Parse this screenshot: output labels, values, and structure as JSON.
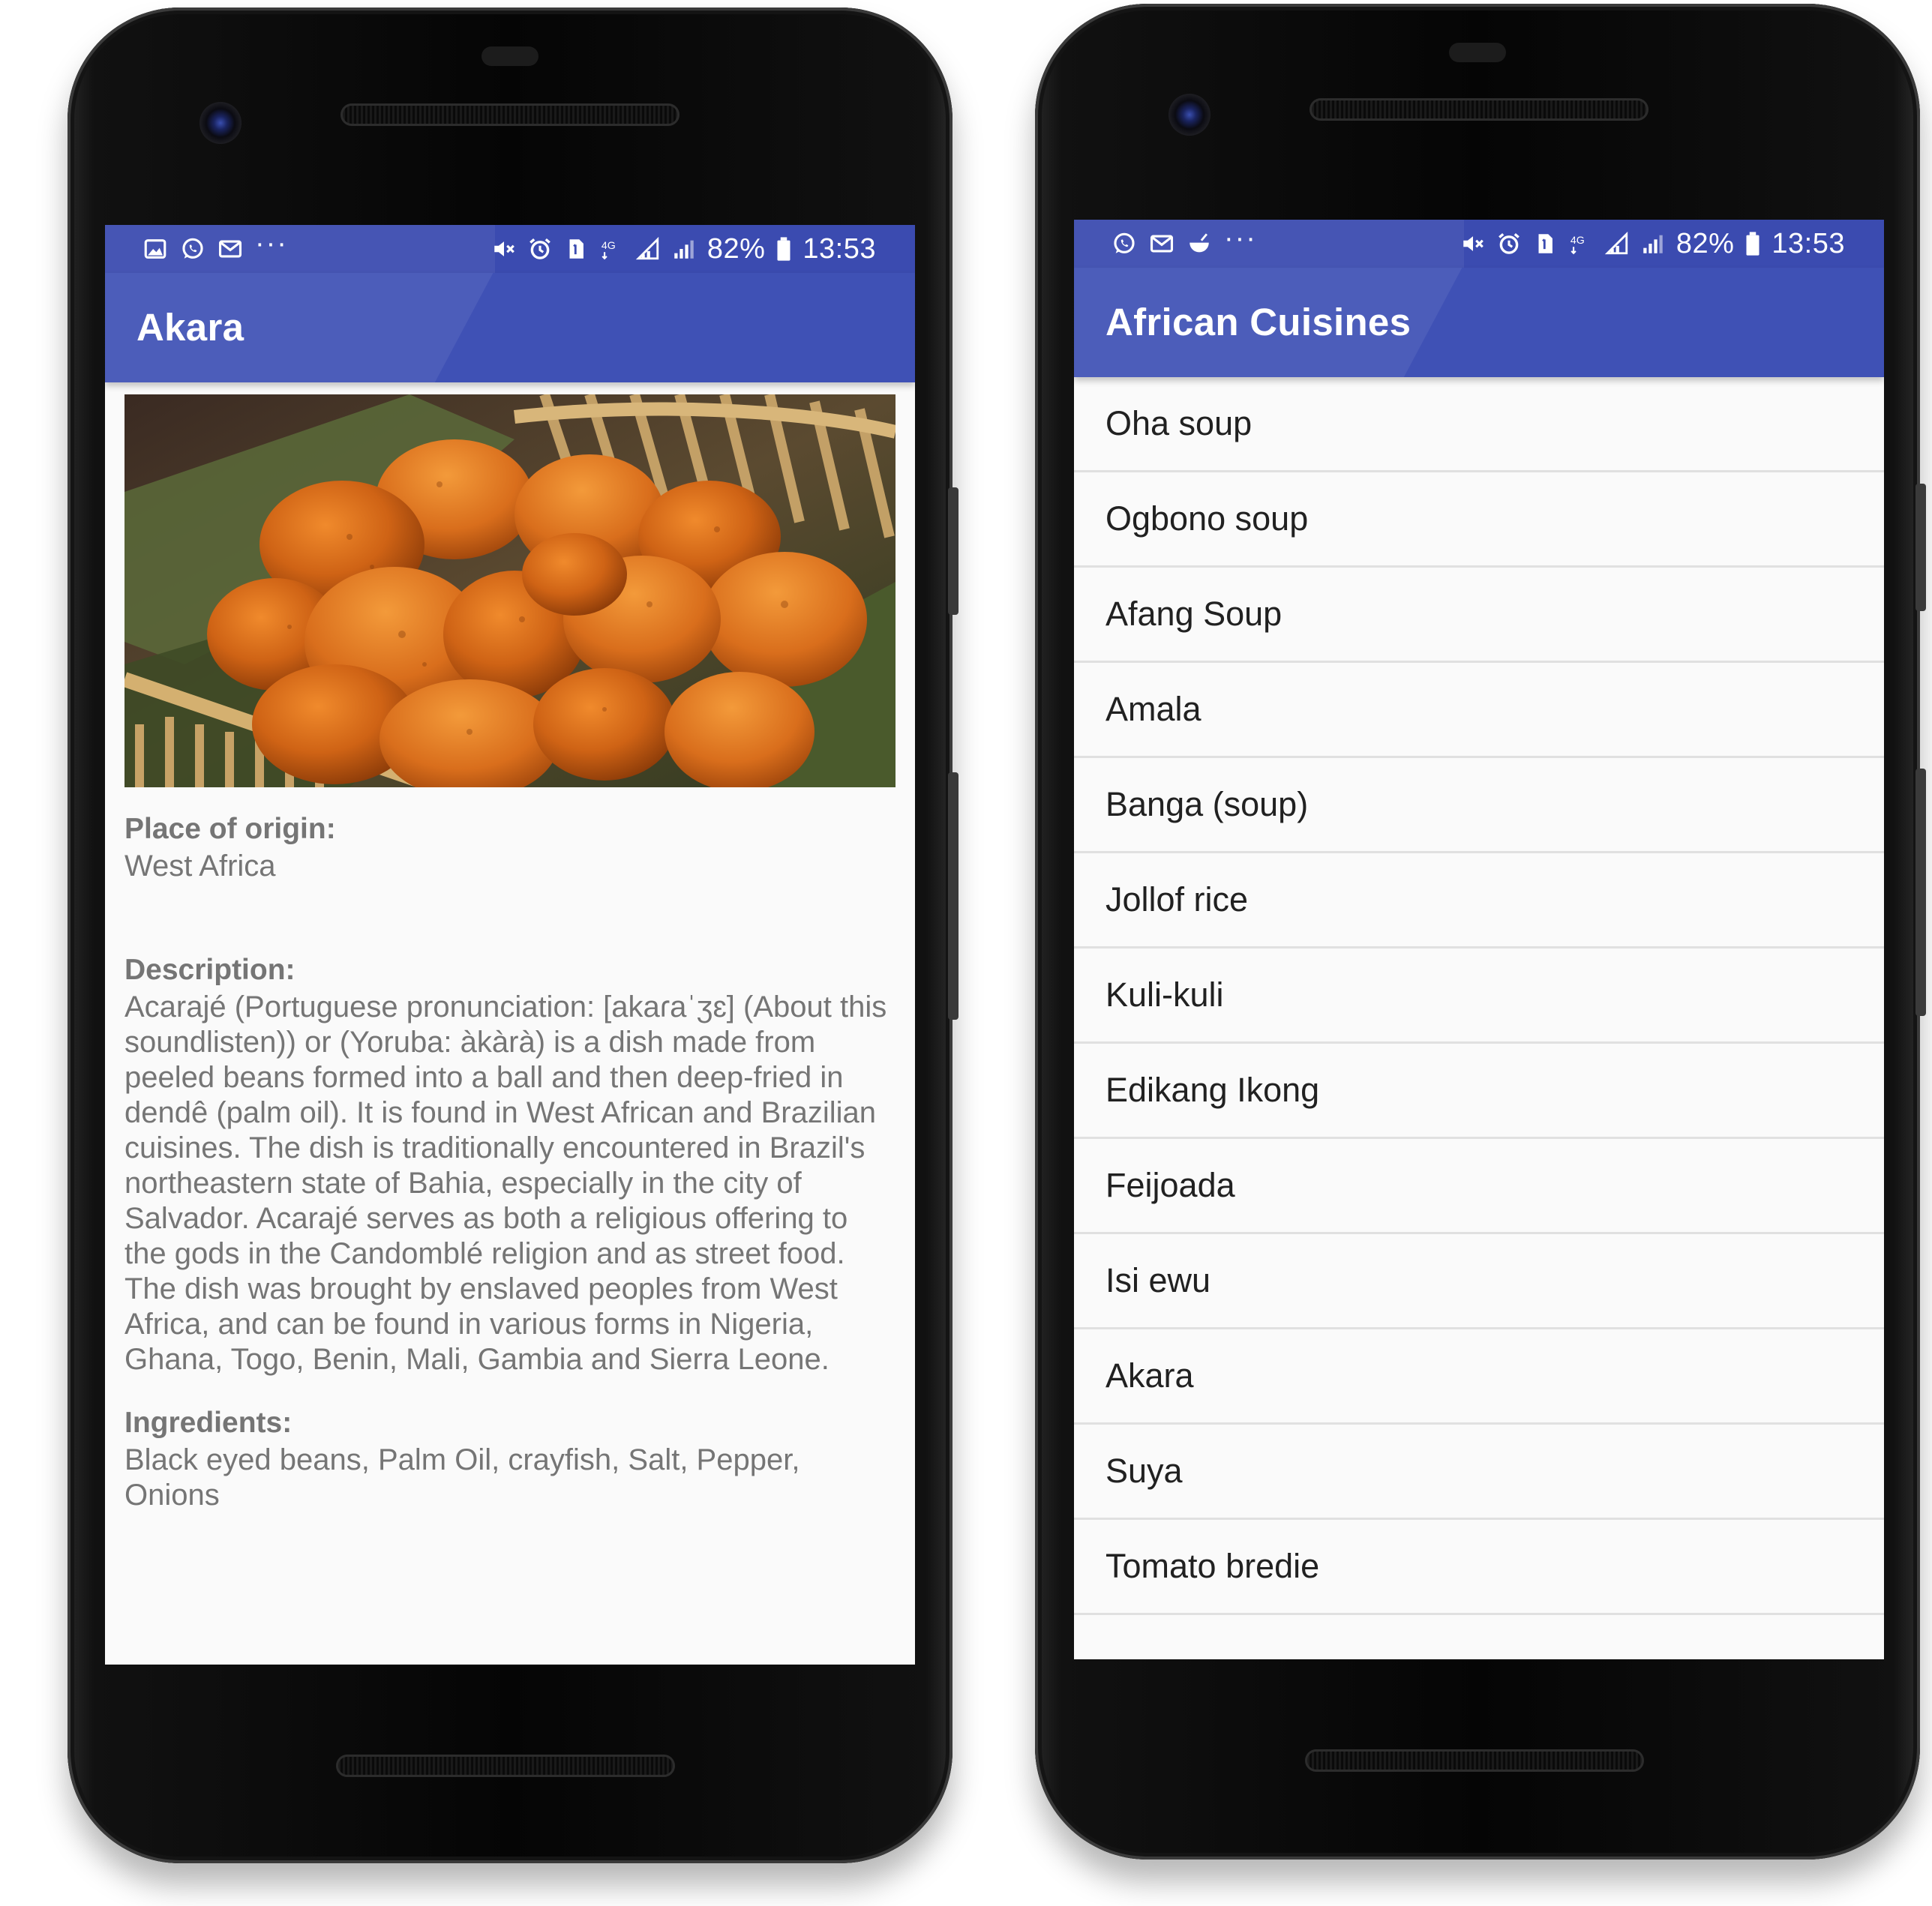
{
  "status_bar": {
    "battery": "82%",
    "time": "13:53",
    "overflow": "···",
    "left_icons_detail": [
      "gallery-icon",
      "whatsapp-icon",
      "email-icon"
    ],
    "left_icons_list": [
      "whatsapp-icon",
      "email-icon",
      "food-bowl-icon"
    ],
    "right_icons": [
      "mute-icon",
      "alarm-icon",
      "sim-icon",
      "network-4g-icon",
      "signal-icon"
    ]
  },
  "detail_screen": {
    "title": "Akara",
    "image_icon": "akara-food-photo",
    "place_label": "Place of origin:",
    "place_value": "West Africa",
    "description_label": "Description:",
    "description_value": "Acarajé (Portuguese pronunciation: [akaɾaˈʒɛ] (About this soundlisten)) or (Yoruba: àkàrà) is a dish made from peeled beans formed into a ball and then deep-fried in dendê (palm oil). It is found in West African and Brazilian cuisines. The dish is traditionally encountered in Brazil's northeastern state of Bahia, especially in the city of Salvador. Acarajé serves as both a religious offering to the gods in the Candomblé religion and as street food. The dish was brought by enslaved peoples from West Africa, and can be found in various forms in Nigeria, Ghana, Togo, Benin, Mali, Gambia and Sierra Leone.",
    "ingredients_label": "Ingredients:",
    "ingredients_value": "Black eyed beans, Palm Oil, crayfish, Salt, Pepper, Onions"
  },
  "list_screen": {
    "title": "African Cuisines",
    "items": [
      "Oha soup",
      "Ogbono soup",
      "Afang Soup",
      "Amala",
      "Banga (soup)",
      "Jollof rice",
      "Kuli-kuli",
      "Edikang Ikong",
      "Feijoada",
      "Isi ewu",
      "Akara",
      "Suya",
      "Tomato bredie"
    ]
  },
  "colors": {
    "primary": "#3f51b5",
    "primary_dark": "#3b4bb0",
    "background": "#fafafa",
    "list_text": "#212121",
    "detail_text": "#757575",
    "divider": "#e0e0e0"
  }
}
